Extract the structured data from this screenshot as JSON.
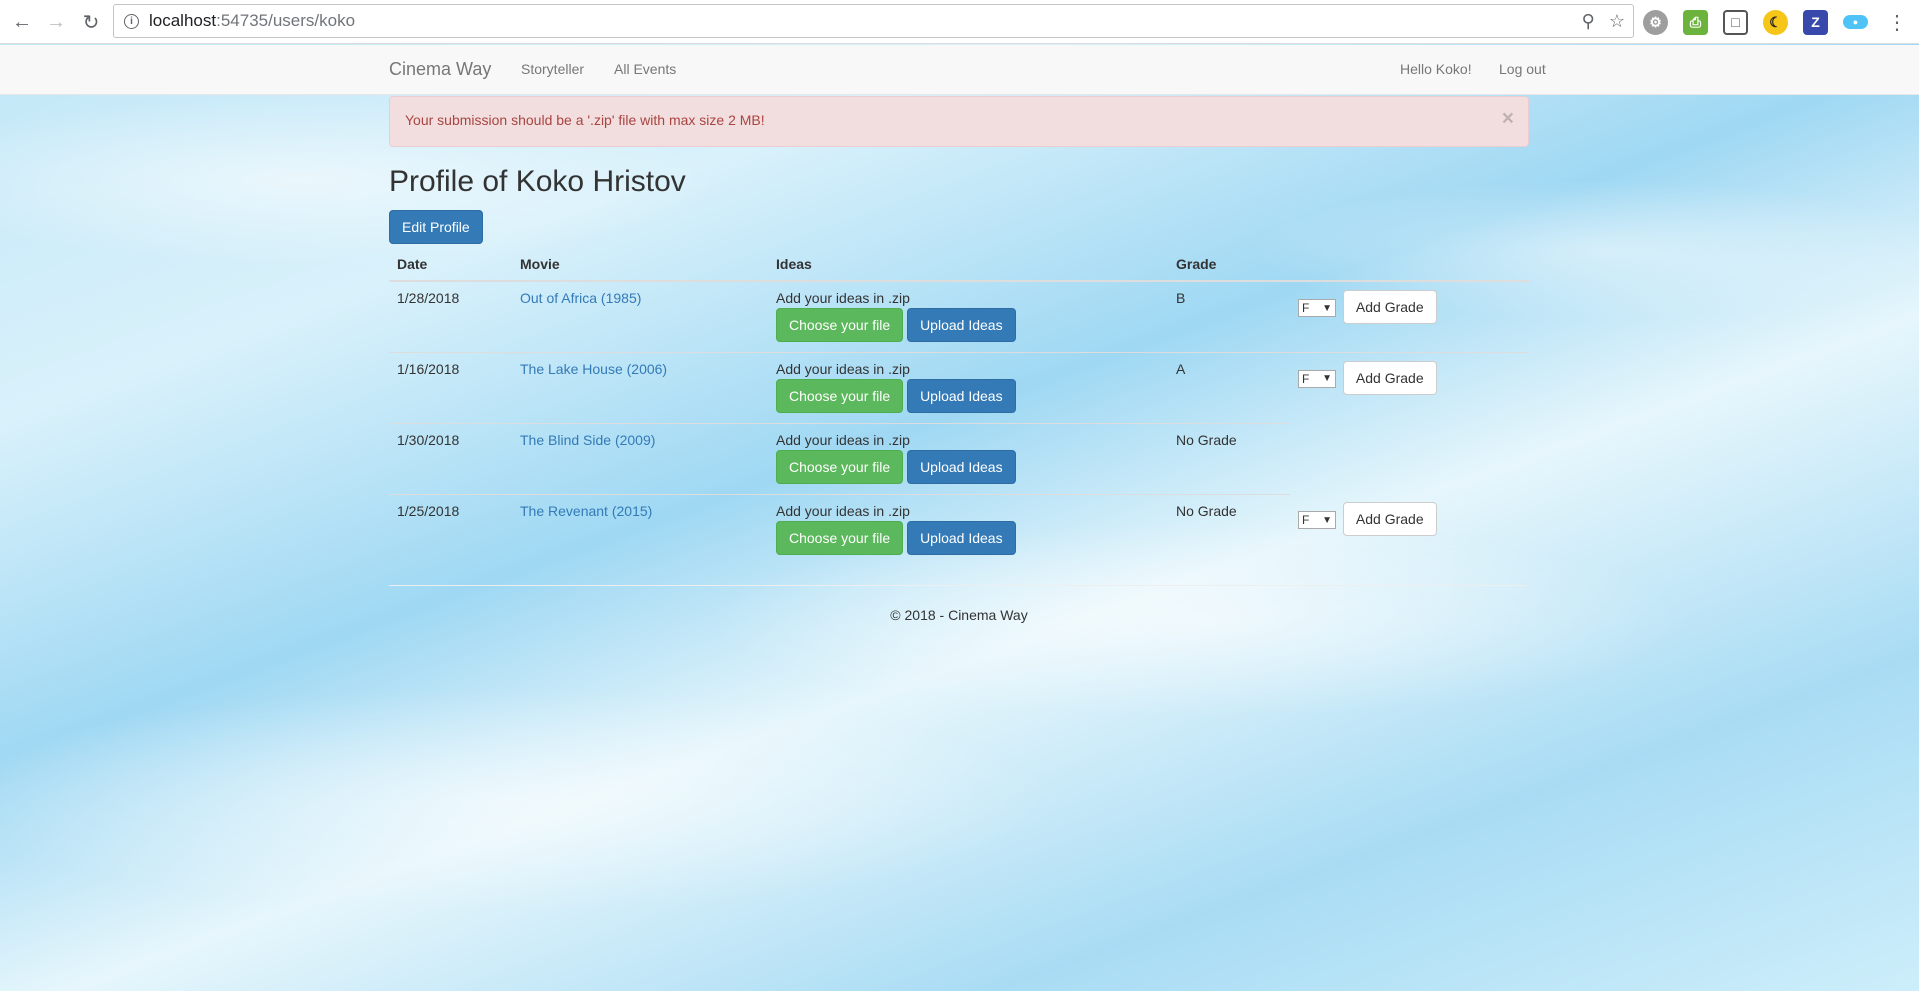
{
  "browser": {
    "url_host": "localhost",
    "url_rest": ":54735/users/koko"
  },
  "navbar": {
    "brand": "Cinema Way",
    "links": [
      "Storyteller",
      "All Events"
    ],
    "greeting": "Hello Koko!",
    "logout": "Log out"
  },
  "alert": {
    "message": "Your submission should be a '.zip' file with max size 2 MB!",
    "close": "×"
  },
  "profile": {
    "title": "Profile of Koko Hristov",
    "edit_button": "Edit Profile"
  },
  "table": {
    "headers": {
      "date": "Date",
      "movie": "Movie",
      "ideas": "Ideas",
      "grade": "Grade"
    },
    "ideas_label": "Add your ideas in .zip",
    "choose_label": "Choose your file",
    "upload_label": "Upload Ideas",
    "add_grade_label": "Add Grade",
    "rows": [
      {
        "date": "1/28/2018",
        "movie": "Out of Africa (1985)",
        "grade": "B",
        "select": "F"
      },
      {
        "date": "1/16/2018",
        "movie": "The Lake House (2006)",
        "grade": "A",
        "select": "F"
      },
      {
        "date": "1/30/2018",
        "movie": "The Blind Side (2009)",
        "grade": "No Grade"
      },
      {
        "date": "1/25/2018",
        "movie": "The Revenant (2015)",
        "grade": "No Grade",
        "select": "F"
      }
    ]
  },
  "footer": {
    "text": "© 2018 - Cinema Way"
  }
}
